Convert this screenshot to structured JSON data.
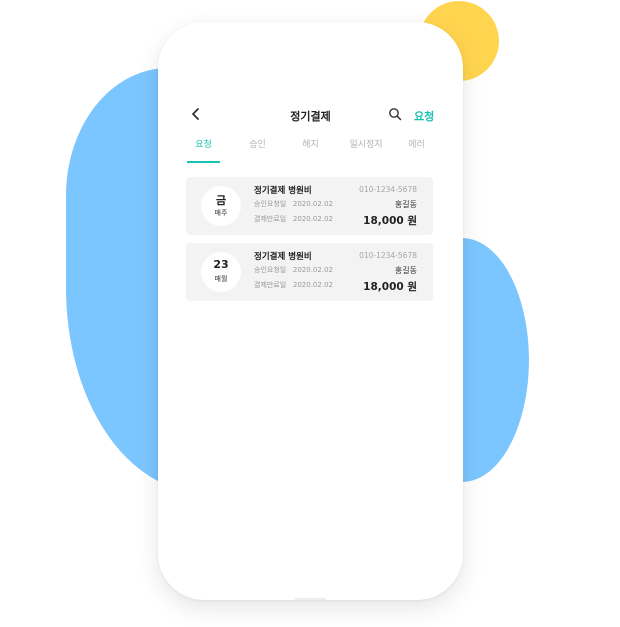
{
  "header": {
    "title": "정기결제",
    "action_label": "요청"
  },
  "tabs": [
    {
      "label": "요청",
      "active": true
    },
    {
      "label": "승인",
      "active": false
    },
    {
      "label": "해지",
      "active": false
    },
    {
      "label": "일시정지",
      "active": false
    },
    {
      "label": "에러",
      "active": false
    }
  ],
  "cards": [
    {
      "badge_main": "금",
      "badge_sub": "매주",
      "title": "정기결제 병원비",
      "date1_label": "승인요청일",
      "date1_value": "2020.02.02",
      "date2_label": "결제만료일",
      "date2_value": "2020.02.02",
      "phone": "010-1234-5678",
      "name": "홍길동",
      "amount": "18,000 원"
    },
    {
      "badge_main": "23",
      "badge_sub": "매월",
      "title": "정기결제 병원비",
      "date1_label": "승인요청일",
      "date1_value": "2020.02.02",
      "date2_label": "결제만료일",
      "date2_value": "2020.02.02",
      "phone": "010-1234-5678",
      "name": "홍길동",
      "amount": "18,000 원"
    }
  ],
  "colors": {
    "accent": "#19c1b3",
    "blob_blue": "#7cc6ff",
    "blob_yellow": "#ffd54f"
  }
}
